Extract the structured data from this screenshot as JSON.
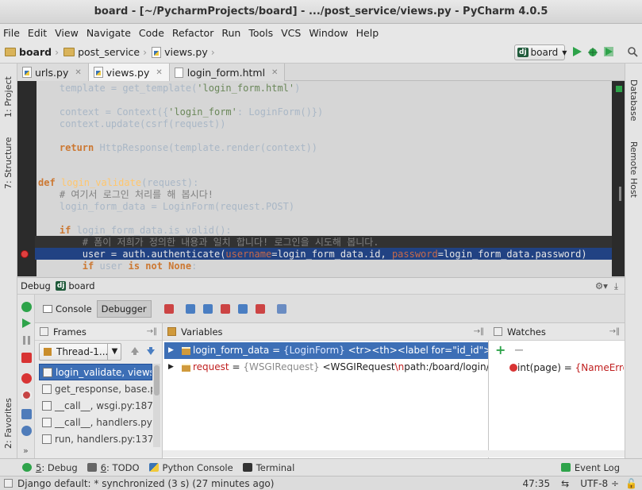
{
  "window": {
    "title": "board - [~/PycharmProjects/board] - .../post_service/views.py - PyCharm 4.0.5"
  },
  "menu": [
    "File",
    "Edit",
    "View",
    "Navigate",
    "Code",
    "Refactor",
    "Run",
    "Tools",
    "VCS",
    "Window",
    "Help"
  ],
  "breadcrumb": [
    "board",
    "post_service",
    "views.py"
  ],
  "run_config": {
    "badge": "dj",
    "name": "board"
  },
  "left_strip": {
    "project": "1: Project",
    "structure": "7: Structure",
    "favorites": "2: Favorites"
  },
  "right_strip": {
    "database": "Database",
    "remote_host": "Remote Host"
  },
  "tabs": [
    {
      "label": "urls.py",
      "active": false
    },
    {
      "label": "views.py",
      "active": true
    },
    {
      "label": "login_form.html",
      "active": false
    }
  ],
  "code": {
    "l1a": "    template = get_template(",
    "l1b": "'login_form.html'",
    "l1c": ")",
    "l2a": "    context = Context({",
    "l2b": "'login_form'",
    "l2c": ": LoginForm()})",
    "l3": "    context.update(csrf(request))",
    "l4a": "    ",
    "l4b": "return",
    "l4c": " HttpResponse(template.render(context))",
    "l5a": "def",
    "l5b": " login_validate",
    "l5c": "(request):",
    "l6": "    # 여기서 로그인 처리를 해 봅시다!",
    "l7": "    login_form_data = LoginForm(request.POST)",
    "l8a": "    ",
    "l8b": "if",
    "l8c": " login_form_data.is_valid():",
    "l9": "        # 폼이 저희가 정의한 내용과 일치 합니다! 로그인을 시도해 봅니다.",
    "l10a": "        user = auth.authenticate(",
    "l10b": "username",
    "l10c": "=login_form_data.id, ",
    "l10d": "password",
    "l10e": "=login_form_data.password)",
    "l11a": "        ",
    "l11b": "if",
    "l11c": " user ",
    "l11d": "is not None",
    "l11e": ":"
  },
  "debug": {
    "label": "Debug",
    "config": "board",
    "tabs": [
      "Console",
      "Debugger"
    ],
    "frames_title": "Frames",
    "thread": "Thread-1...",
    "frames": [
      "login_validate, views.py:",
      "get_response, base.py",
      "__call__, wsgi.py:187",
      "__call__, handlers.py:6",
      "run, handlers.py:137"
    ],
    "variables_title": "Variables",
    "variables": [
      {
        "name": "login_form_data",
        "eq": " = ",
        "type": "{LoginForm}",
        "value": " <tr><th><label for=\"id_id\">ID:</lab"
      },
      {
        "name": "request",
        "eq": " = ",
        "type": "{WSGIRequest}",
        "value": " <WSGIRequest",
        "extra": "\\n",
        "value2": "path:/board/login/valid"
      }
    ],
    "watches_title": "Watches",
    "watch": {
      "expr": "int(page) = ",
      "value": "{NameError}"
    }
  },
  "bottom_tools": [
    {
      "num": "5",
      "label": ": Debug"
    },
    {
      "num": "6",
      "label": ": TODO"
    },
    {
      "num": "",
      "label": "Python Console"
    },
    {
      "num": "",
      "label": "Terminal"
    }
  ],
  "event_log": "Event Log",
  "status": {
    "message": "Django default: * synchronized (3 s) (27 minutes ago)",
    "position": "47:35",
    "encoding": "UTF-8 ÷"
  },
  "colors": {
    "editor_bg": "#2b2b2b",
    "selection": "#214283",
    "keyword": "#cc7832",
    "string": "#6a8759"
  }
}
